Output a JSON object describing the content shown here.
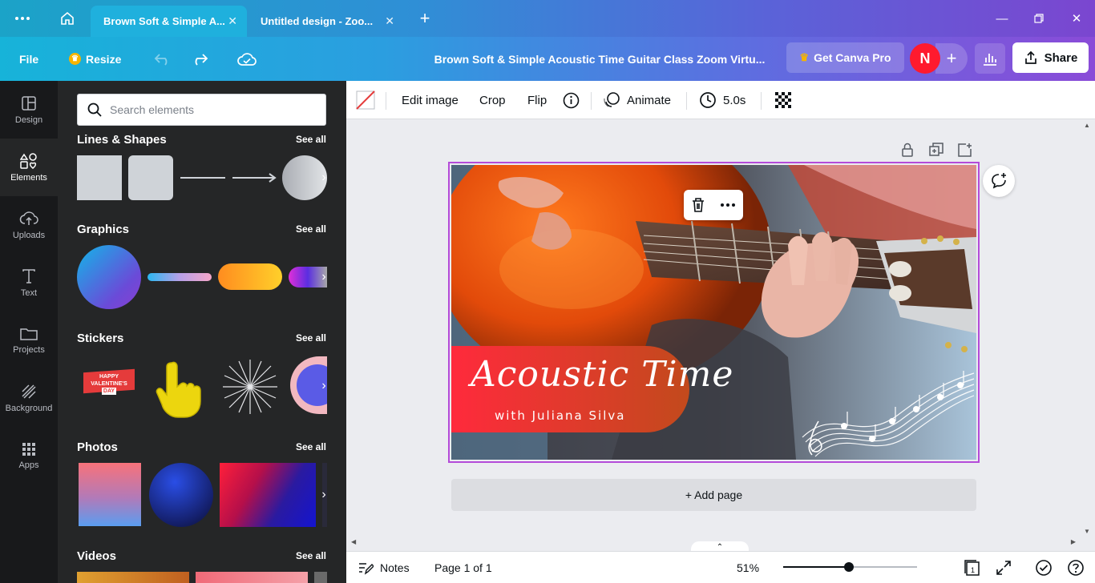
{
  "browser": {
    "tabs": [
      {
        "label": "Brown Soft & Simple A...",
        "active": true
      },
      {
        "label": "Untitled design - Zoo...",
        "active": false
      }
    ]
  },
  "header": {
    "file_label": "File",
    "resize_label": "Resize",
    "doc_title": "Brown Soft & Simple Acoustic Time Guitar Class Zoom Virtu...",
    "pro_label": "Get Canva Pro",
    "avatar_initial": "N",
    "share_label": "Share"
  },
  "rail": {
    "items": [
      {
        "label": "Design",
        "icon": "layout-icon"
      },
      {
        "label": "Elements",
        "icon": "shapes-icon",
        "active": true
      },
      {
        "label": "Uploads",
        "icon": "cloud-upload-icon"
      },
      {
        "label": "Text",
        "icon": "text-icon"
      },
      {
        "label": "Projects",
        "icon": "folder-icon"
      },
      {
        "label": "Background",
        "icon": "background-icon"
      },
      {
        "label": "Apps",
        "icon": "apps-grid-icon"
      }
    ]
  },
  "panel": {
    "search_placeholder": "Search elements",
    "see_all": "See all",
    "sections": {
      "lines": "Lines & Shapes",
      "graphics": "Graphics",
      "stickers": "Stickers",
      "photos": "Photos",
      "videos": "Videos"
    },
    "sticker_text": [
      "HAPPY",
      "VALENTINE'S",
      "DAY"
    ]
  },
  "toolbar": {
    "edit_image": "Edit image",
    "crop": "Crop",
    "flip": "Flip",
    "animate": "Animate",
    "duration": "5.0s"
  },
  "design": {
    "title": "Acoustic Time",
    "subtitle": "with Juliana Silva"
  },
  "canvas": {
    "add_page": "+ Add page"
  },
  "footer": {
    "notes": "Notes",
    "page_indicator": "Page 1 of 1",
    "zoom": "51%",
    "zoom_fraction": 0.49,
    "page_count_badge": "1"
  },
  "colors": {
    "selection": "#b44bd9",
    "avatar": "#ff1a2e",
    "banner_start": "#ff2a3c",
    "banner_end": "#c24a1c"
  }
}
